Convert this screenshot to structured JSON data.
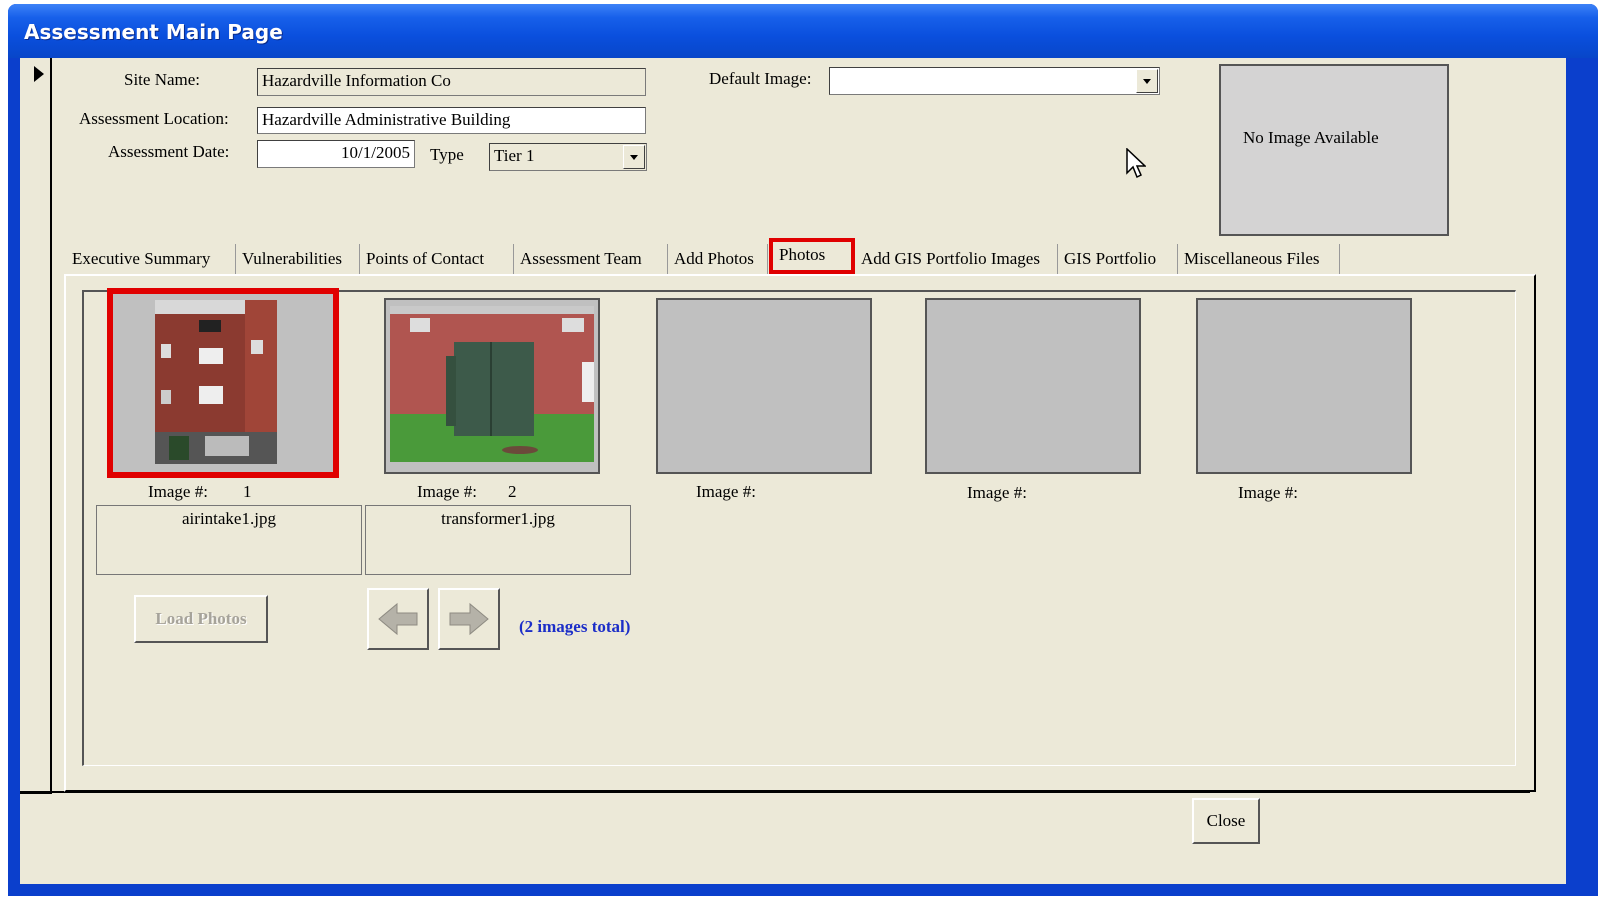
{
  "window": {
    "title": "Assessment Main Page"
  },
  "header": {
    "site_name_label": "Site Name:",
    "site_name_value": "Hazardville Information Co",
    "location_label": "Assessment Location:",
    "location_value": "Hazardville Administrative Building",
    "date_label": "Assessment Date:",
    "date_value": "10/1/2005",
    "type_label": "Type",
    "type_value": "Tier 1",
    "default_image_label": "Default Image:",
    "default_image_value": "",
    "preview_text": "No Image Available"
  },
  "tabs": [
    {
      "label": "Executive Summary"
    },
    {
      "label": "Vulnerabilities"
    },
    {
      "label": "Points of Contact"
    },
    {
      "label": "Assessment Team"
    },
    {
      "label": "Add Photos"
    },
    {
      "label": "Photos",
      "active": true
    },
    {
      "label": "Add GIS Portfolio Images"
    },
    {
      "label": "GIS Portfolio"
    },
    {
      "label": "Miscellaneous Files"
    }
  ],
  "photos": {
    "image_label": "Image #:",
    "slots": [
      {
        "number": "1",
        "filename": "airintake1.jpg"
      },
      {
        "number": "2",
        "filename": "transformer1.jpg"
      },
      {
        "number": "",
        "filename": ""
      },
      {
        "number": "",
        "filename": ""
      },
      {
        "number": "",
        "filename": ""
      }
    ],
    "load_button": "Load Photos",
    "total_text": "(2 images total)"
  },
  "footer": {
    "close_button": "Close"
  },
  "colors": {
    "highlight": "#e00000",
    "total_text": "#1c2ec8",
    "face": "#ece9d8"
  },
  "icons": [
    "arrow-left-icon",
    "arrow-right-icon",
    "record-selector-arrow-icon",
    "mouse-cursor-icon",
    "dropdown-arrow-icon"
  ]
}
